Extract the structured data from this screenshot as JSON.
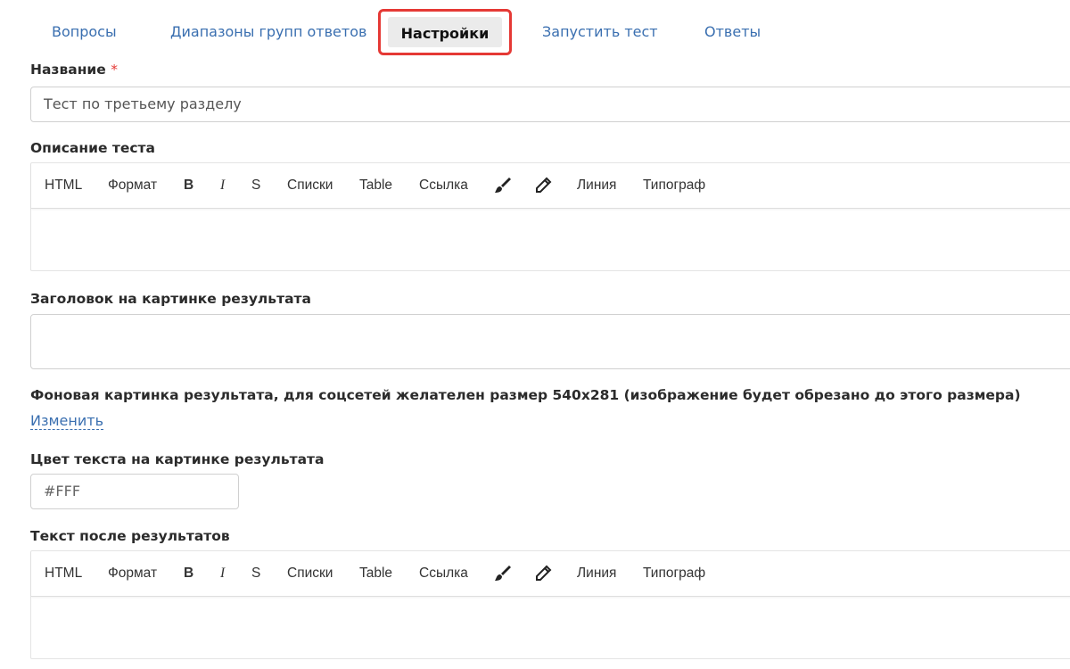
{
  "tabs": {
    "questions": "Вопросы",
    "answer_group_ranges": "Диапазоны групп ответов",
    "settings": "Настройки",
    "run_test": "Запустить тест",
    "answers": "Ответы"
  },
  "fields": {
    "name_label": "Название",
    "name_required_mark": "*",
    "name_value": "Тест по третьему разделу",
    "description_label": "Описание теста",
    "result_heading_label": "Заголовок на картинке результата",
    "result_heading_value": "",
    "background_label": "Фоновая картинка результата, для соцсетей желателен размер 540x281 (изображение будет обрезано до этого размера)",
    "change_link": "Изменить",
    "text_color_label": "Цвет текста на картинке результата",
    "text_color_value": "#FFF",
    "after_results_label": "Текст после результатов"
  },
  "toolbar": {
    "html": "HTML",
    "format": "Формат",
    "bold": "B",
    "italic": "I",
    "strike": "S",
    "lists": "Списки",
    "table": "Table",
    "link": "Ссылка",
    "brush_icon": "brush-icon",
    "pencil_icon": "pencil-icon",
    "line": "Линия",
    "typograph": "Типограф"
  },
  "colors": {
    "tab_text": "#3a6fb0",
    "highlight_frame": "#e53935",
    "required_mark": "#e53935"
  }
}
